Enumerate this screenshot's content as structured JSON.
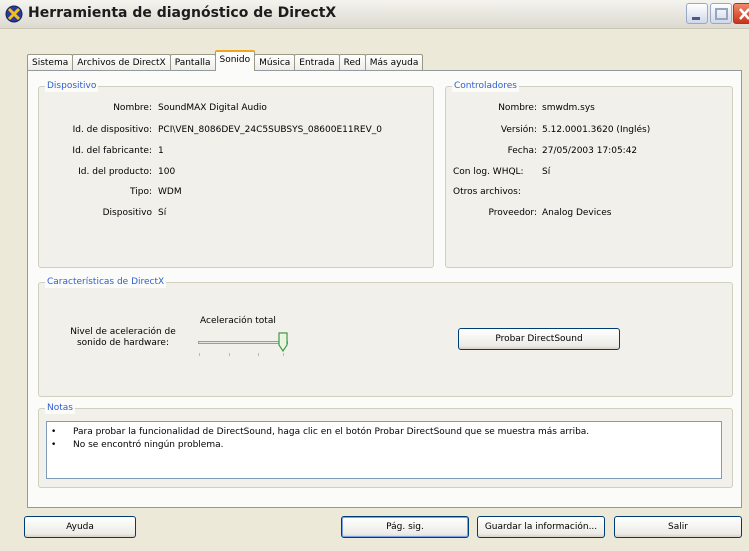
{
  "window": {
    "title": "Herramienta de diagnóstico de DirectX"
  },
  "tabs": [
    {
      "label": "Sistema"
    },
    {
      "label": "Archivos de DirectX"
    },
    {
      "label": "Pantalla"
    },
    {
      "label": "Sonido",
      "active": true
    },
    {
      "label": "Música"
    },
    {
      "label": "Entrada"
    },
    {
      "label": "Red"
    },
    {
      "label": "Más ayuda"
    }
  ],
  "dispositivo": {
    "title": "Dispositivo",
    "rows": [
      {
        "label": "Nombre:",
        "value": "SoundMAX Digital Audio"
      },
      {
        "label": "Id. de dispositivo:",
        "value": "PCI\\VEN_8086DEV_24C5SUBSYS_08600E11REV_0"
      },
      {
        "label": "Id. del fabricante:",
        "value": "1"
      },
      {
        "label": "Id. del producto:",
        "value": "100"
      },
      {
        "label": "Tipo:",
        "value": "WDM"
      },
      {
        "label": "Dispositivo",
        "value": "Sí"
      }
    ]
  },
  "controladores": {
    "title": "Controladores",
    "rows": [
      {
        "label": "Nombre:",
        "value": "smwdm.sys"
      },
      {
        "label": "Versión:",
        "value": "5.12.0001.3620 (Inglés)"
      },
      {
        "label": "Fecha:",
        "value": "27/05/2003 17:05:42"
      },
      {
        "label": "Con log. WHQL:",
        "value": "Sí"
      },
      {
        "label": "Otros archivos:",
        "value": ""
      },
      {
        "label": "Proveedor:",
        "value": "Analog Devices"
      }
    ]
  },
  "caracteristicas": {
    "title": "Características de DirectX",
    "nivel_label": "Nivel de aceleración de sonido de hardware:",
    "slider_value_label": "Aceleración total",
    "slider_level": 1.0,
    "probar_button": "Probar DirectSound"
  },
  "notas": {
    "title": "Notas",
    "lines": [
      "Para probar la funcionalidad de DirectSound, haga clic en el botón Probar DirectSound que se muestra más arriba.",
      "No se encontró ningún problema."
    ]
  },
  "footer": {
    "ayuda": "Ayuda",
    "pag_sig": "Pág. sig.",
    "guardar": "Guardar la información...",
    "salir": "Salir"
  }
}
